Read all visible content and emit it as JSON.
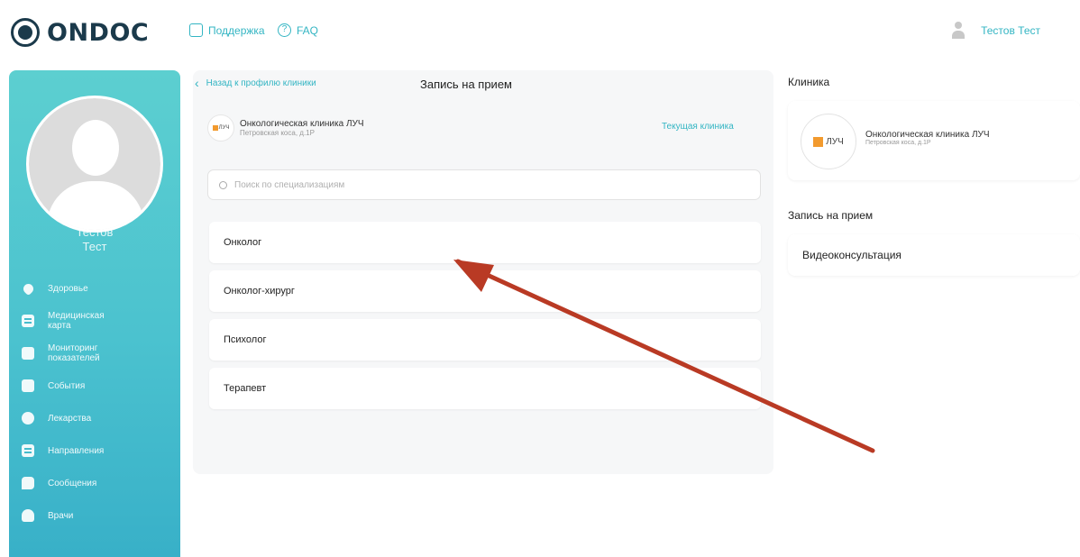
{
  "header": {
    "logo_text": "ONDOC",
    "support_label": "Поддержка",
    "faq_label": "FAQ",
    "user_name": "Тестов Тест"
  },
  "sidebar": {
    "user_first": "Тестов",
    "user_last": "Тест",
    "items": [
      {
        "label": "Здоровье",
        "icon": "heart-icon"
      },
      {
        "label": "Медицинская карта",
        "icon": "medical-card-icon"
      },
      {
        "label": "Мониторинг показателей",
        "icon": "monitoring-icon"
      },
      {
        "label": "События",
        "icon": "events-icon"
      },
      {
        "label": "Лекарства",
        "icon": "medicine-icon"
      },
      {
        "label": "Направления",
        "icon": "referral-icon"
      },
      {
        "label": "Сообщения",
        "icon": "messages-icon"
      },
      {
        "label": "Врачи",
        "icon": "doctors-icon"
      }
    ]
  },
  "main": {
    "back_label": "Назад к профилю клиники",
    "title": "Запись на прием",
    "clinic_name": "Онкологическая клиника ЛУЧ",
    "clinic_address": "Петровская коса, д.1Р",
    "clinic_logo_text": "ЛУЧ",
    "current_clinic_label": "Текущая клиника",
    "search_placeholder": "Поиск по специализациям",
    "specializations": [
      "Онколог",
      "Онколог-хирург",
      "Психолог",
      "Терапевт"
    ]
  },
  "right": {
    "clinic_heading": "Клиника",
    "clinic_name": "Онкологическая клиника ЛУЧ",
    "clinic_address": "Петровская коса, д.1Р",
    "clinic_logo_text": "ЛУЧ",
    "appointment_heading": "Запись на прием",
    "appointment_type": "Видеоконсультация"
  },
  "annotation": {
    "arrow_color": "#c0392b"
  },
  "colors": {
    "accent": "#33b5c3",
    "sidebar_top": "#5ccfd0",
    "sidebar_bottom": "#38b0c8",
    "logo": "#1b3a4b"
  }
}
